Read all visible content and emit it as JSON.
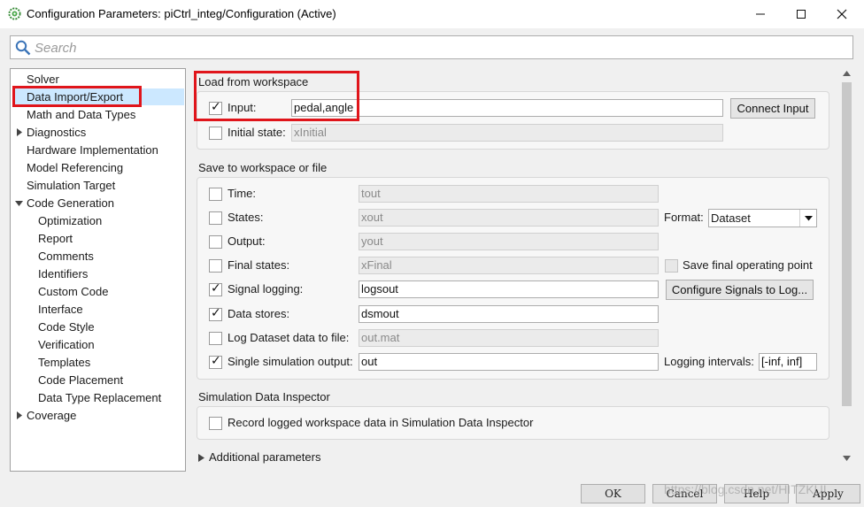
{
  "window": {
    "title": "Configuration Parameters: piCtrl_integ/Configuration (Active)"
  },
  "search": {
    "placeholder": "Search"
  },
  "tree": {
    "items": [
      {
        "label": "Solver"
      },
      {
        "label": "Data Import/Export",
        "selected": true
      },
      {
        "label": "Math and Data Types"
      },
      {
        "label": "Diagnostics",
        "expandable": true,
        "expanded": false
      },
      {
        "label": "Hardware Implementation"
      },
      {
        "label": "Model Referencing"
      },
      {
        "label": "Simulation Target"
      },
      {
        "label": "Code Generation",
        "expandable": true,
        "expanded": true
      },
      {
        "label": "Optimization"
      },
      {
        "label": "Report"
      },
      {
        "label": "Comments"
      },
      {
        "label": "Identifiers"
      },
      {
        "label": "Custom Code"
      },
      {
        "label": "Interface"
      },
      {
        "label": "Code Style"
      },
      {
        "label": "Verification"
      },
      {
        "label": "Templates"
      },
      {
        "label": "Code Placement"
      },
      {
        "label": "Data Type Replacement"
      },
      {
        "label": "Coverage",
        "expandable": true,
        "expanded": false
      }
    ]
  },
  "load": {
    "title": "Load from workspace",
    "input": {
      "label": "Input:",
      "checked": true,
      "value": "pedal,angle"
    },
    "initial_state": {
      "label": "Initial state:",
      "checked": false,
      "value": "xInitial"
    },
    "connect_button": "Connect Input"
  },
  "save": {
    "title": "Save to workspace or file",
    "time": {
      "label": "Time:",
      "checked": false,
      "value": "tout"
    },
    "states": {
      "label": "States:",
      "checked": false,
      "value": "xout"
    },
    "output": {
      "label": "Output:",
      "checked": false,
      "value": "yout"
    },
    "final_states": {
      "label": "Final states:",
      "checked": false,
      "value": "xFinal"
    },
    "signal_logging": {
      "label": "Signal logging:",
      "checked": true,
      "value": "logsout"
    },
    "data_stores": {
      "label": "Data stores:",
      "checked": true,
      "value": "dsmout"
    },
    "log_dataset": {
      "label": "Log Dataset data to file:",
      "checked": false,
      "value": "out.mat"
    },
    "single_output": {
      "label": "Single simulation output:",
      "checked": true,
      "value": "out"
    },
    "format_label": "Format:",
    "format_value": "Dataset",
    "save_final_op": "Save final operating point",
    "configure_button": "Configure Signals to Log...",
    "logging_intervals_label": "Logging intervals:",
    "logging_intervals_value": "[-inf, inf]"
  },
  "sdi": {
    "title": "Simulation Data Inspector",
    "record_label": "Record logged workspace data in Simulation Data Inspector",
    "checked": false
  },
  "additional": {
    "label": "Additional parameters"
  },
  "buttons": {
    "ok": "OK",
    "cancel": "Cancel",
    "help": "Help",
    "apply": "Apply"
  },
  "watermark": "https://blog.csdn.net/HITZKUI",
  "colors": {
    "highlight_border": "#e0151b",
    "selection": "#cce8ff"
  }
}
